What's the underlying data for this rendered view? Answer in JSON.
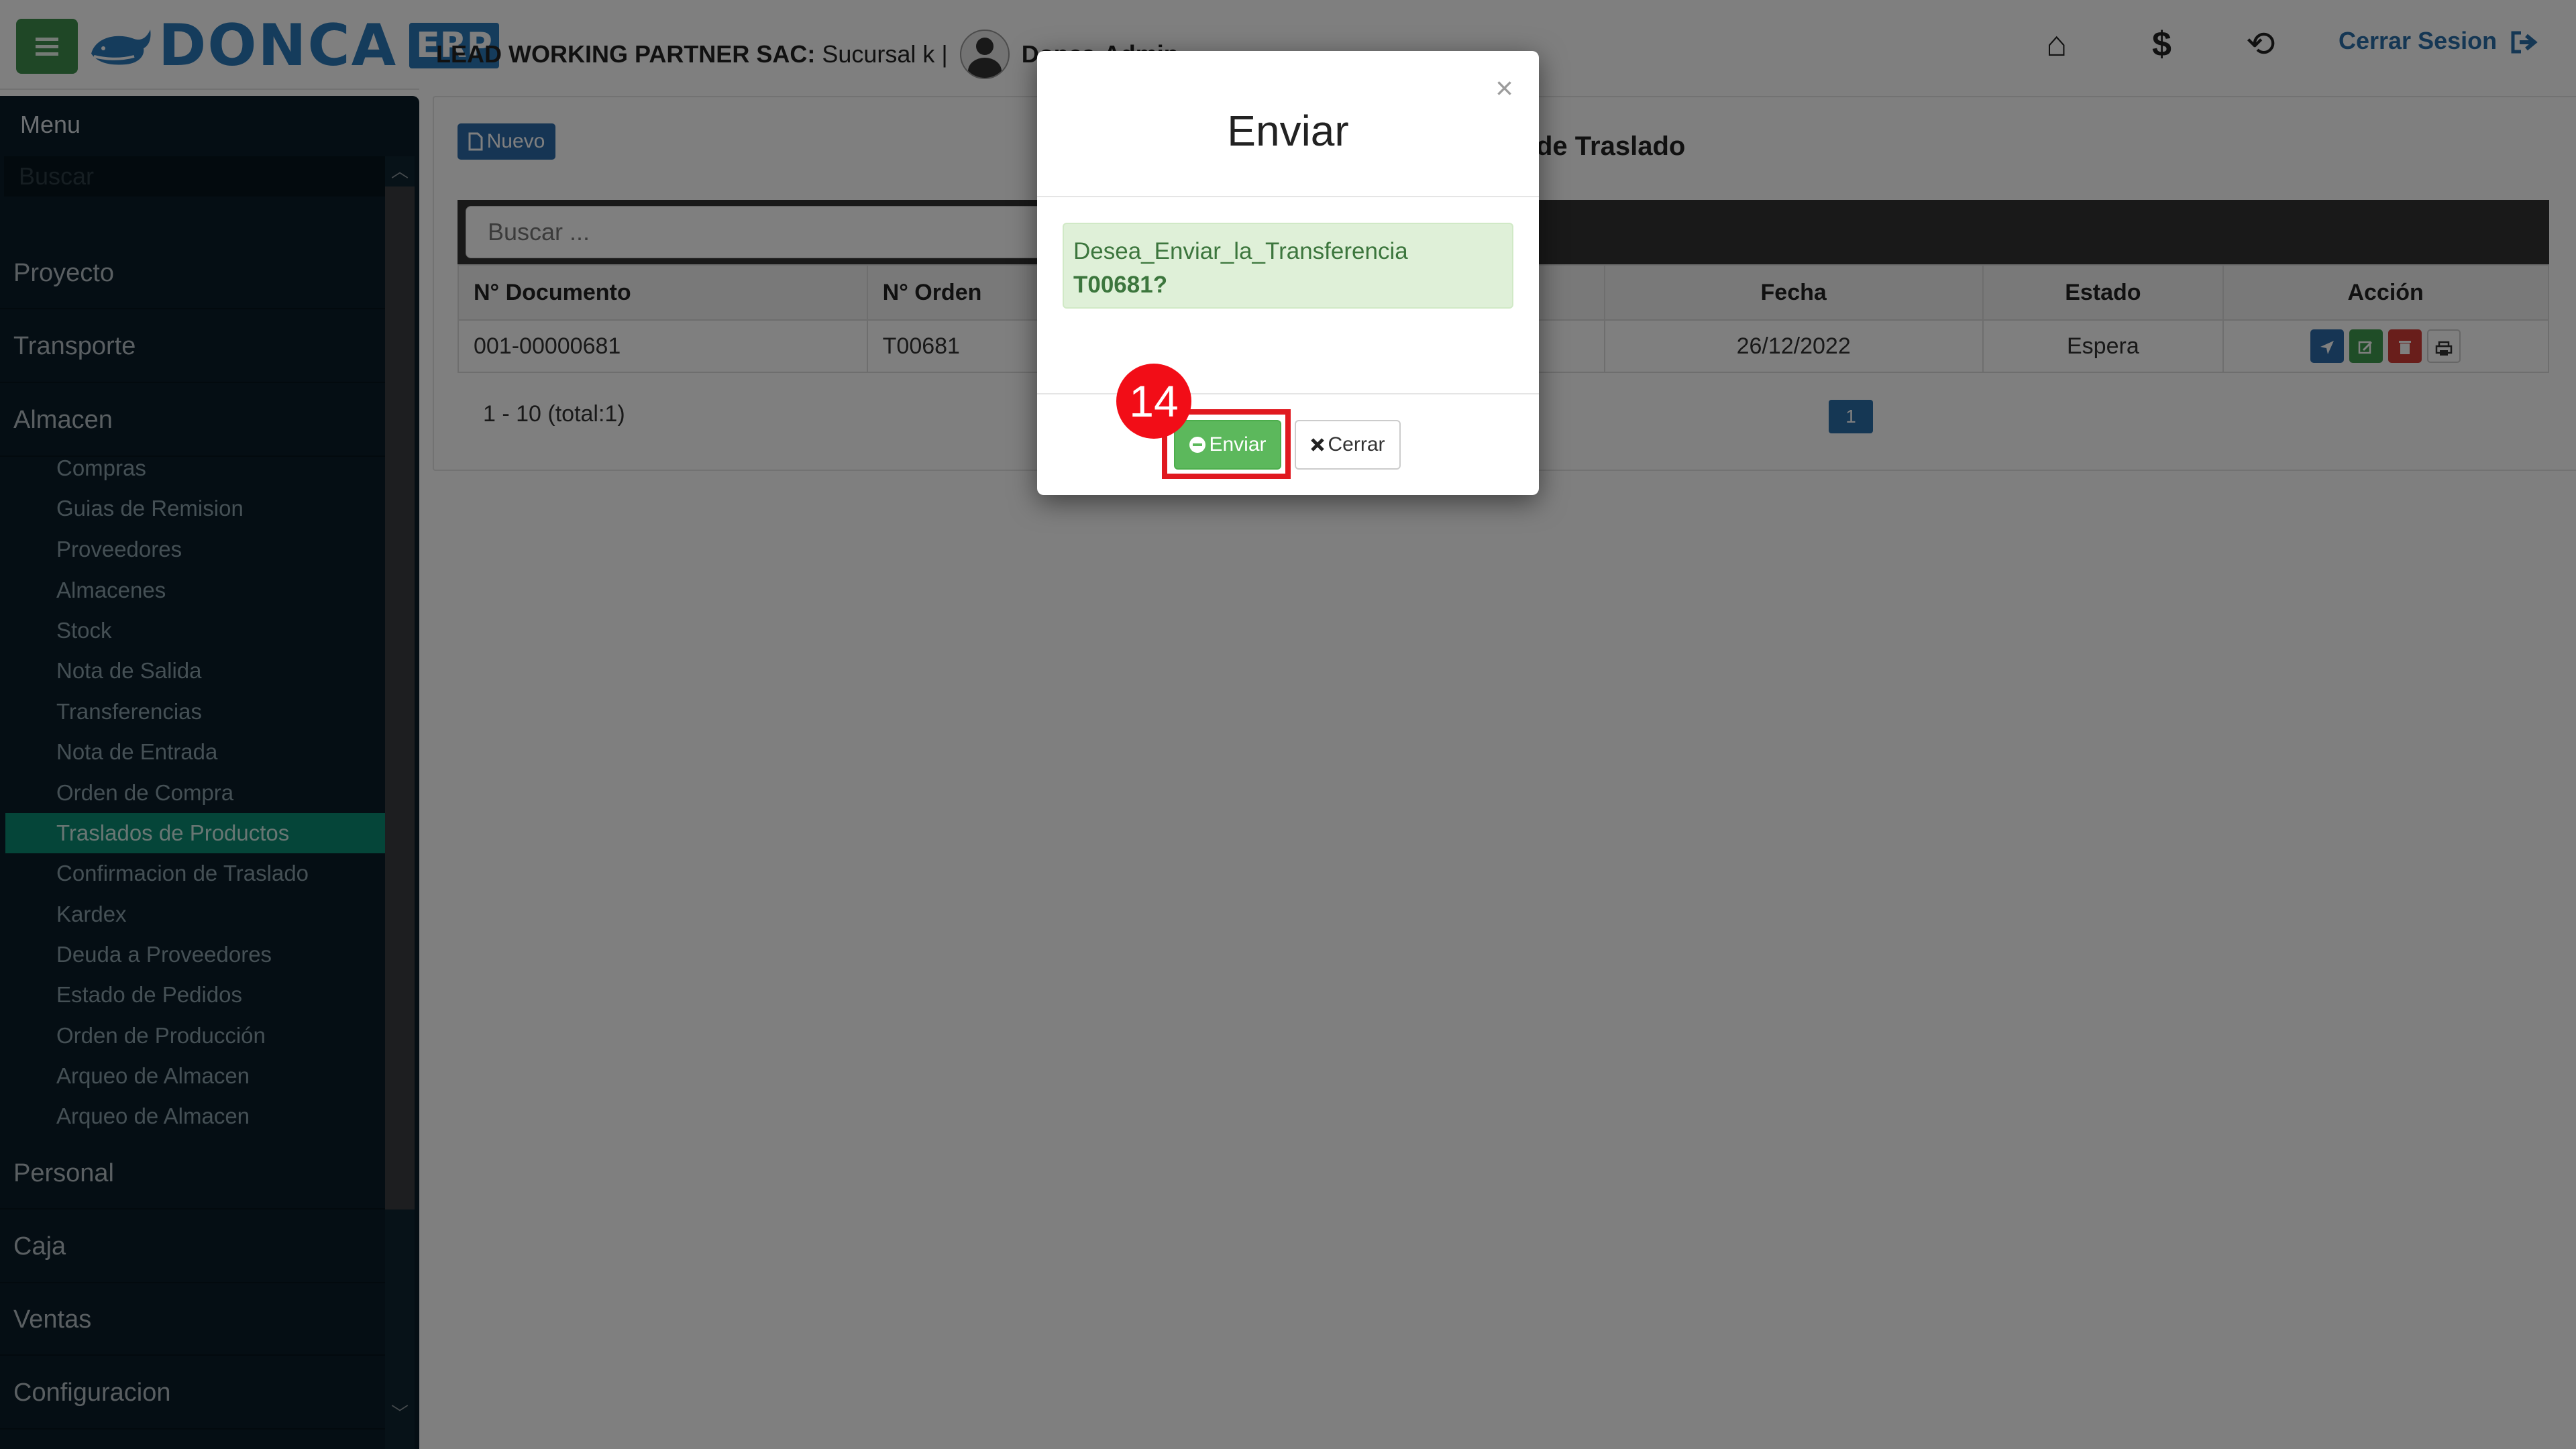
{
  "topbar": {
    "logo_text": "DONCA",
    "logo_badge": "ERP",
    "company_name": "LEAD WORKING PARTNER SAC:",
    "branch": "Sucursal k |",
    "user": "Donca-Admin -",
    "home_glyph": "⌂",
    "money_glyph": "$",
    "lock_glyph": "⟲",
    "logout_label": "Cerrar Sesion"
  },
  "sidebar": {
    "title": "Menu",
    "search_placeholder": "Buscar",
    "top_items": [
      "Proyecto",
      "Transporte",
      "Almacen"
    ],
    "almacen_items": [
      "Compras",
      "Guias de Remision",
      "Proveedores",
      "Almacenes",
      "Stock",
      "Nota de Salida",
      "Transferencias",
      "Nota de Entrada",
      "Orden de Compra",
      "Traslados de Productos",
      "Confirmacion de Traslado",
      "Kardex",
      "Deuda a Proveedores",
      "Estado de Pedidos",
      "Orden de Producción",
      "Arqueo de Almacen",
      "Arqueo de Almacen"
    ],
    "active_item": "Traslados de Productos",
    "bottom_items": [
      "Personal",
      "Caja",
      "Ventas",
      "Configuracion"
    ]
  },
  "main": {
    "new_button": "Nuevo",
    "title": "de Traslado",
    "search_placeholder": "Buscar ...",
    "columns": [
      "N° Documento",
      "N° Orden",
      "Fecha",
      "Estado",
      "Acción"
    ],
    "rows": [
      {
        "documento": "001-00000681",
        "orden": "T00681",
        "fecha": "26/12/2022",
        "estado": "Espera"
      }
    ],
    "pager_info": "1 - 10 (total:1)",
    "current_page": "1"
  },
  "modal": {
    "title": "Enviar",
    "close_glyph": "×",
    "message": "Desea_Enviar_la_Transferencia",
    "message_bold": "T00681?",
    "primary_button": "Enviar",
    "secondary_button": "Cerrar"
  },
  "annotation": {
    "step": "14"
  },
  "colors": {
    "accent_blue": "#2a79b8",
    "success_green": "#5cb85c",
    "sidebar_bg": "#0b1d28",
    "active_item": "#0a8a73",
    "highlight_red": "#e0191f"
  }
}
